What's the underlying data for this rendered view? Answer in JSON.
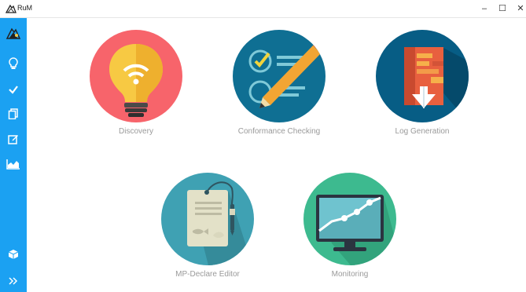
{
  "window": {
    "title": "RuM"
  },
  "sidebar": {
    "items": [
      {
        "icon": "app-logo-icon"
      },
      {
        "icon": "lightbulb-icon"
      },
      {
        "icon": "check-icon"
      },
      {
        "icon": "copy-icon"
      },
      {
        "icon": "edit-icon"
      },
      {
        "icon": "area-chart-icon"
      },
      {
        "icon": "cube-icon"
      },
      {
        "icon": "expand-icon"
      }
    ]
  },
  "tiles": [
    {
      "label": "Discovery",
      "color": "#f7646b"
    },
    {
      "label": "Conformance Checking",
      "color": "#0f6f93"
    },
    {
      "label": "Log Generation",
      "color": "#075d85"
    },
    {
      "label": "MP-Declare Editor",
      "color": "#3fa1b3"
    },
    {
      "label": "Monitoring",
      "color": "#3dba8f"
    }
  ]
}
